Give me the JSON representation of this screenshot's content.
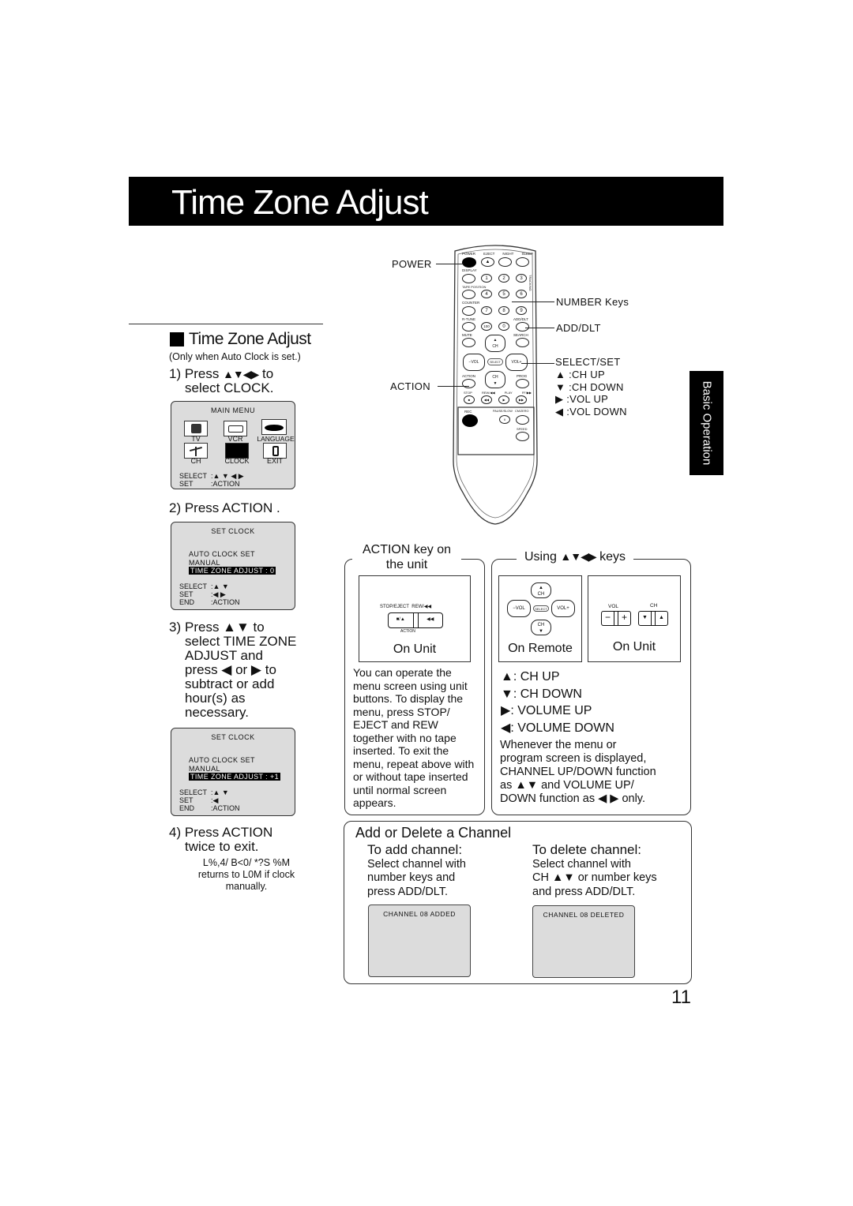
{
  "page": {
    "title": "Time Zone Adjust",
    "side_tab": "Basic Operation",
    "page_number": "11"
  },
  "left": {
    "heading": "Time Zone Adjust",
    "note": "(Only when Auto Clock is set.)",
    "step1": {
      "num": "1)",
      "line1_pre": "Press",
      "arrows": "▲▼◀▶",
      "line1_post": "to",
      "line2": "select  CLOCK."
    },
    "main_menu": {
      "title": "MAIN MENU",
      "items": [
        "TV",
        "VCR",
        "LANGUAGE",
        "CH",
        "CLOCK",
        "EXIT"
      ],
      "selected": "CLOCK",
      "controls": [
        {
          "key": "SELECT",
          "value": ":▲ ▼ ◀ ▶"
        },
        {
          "key": "SET",
          "value": ":ACTION"
        }
      ]
    },
    "step2": {
      "text": "2) Press ACTION ."
    },
    "set_clock_1": {
      "title": "SET CLOCK",
      "lines": [
        "AUTO CLOCK SET",
        "MANUAL"
      ],
      "highlight": "TIME ZONE ADJUST  : 0",
      "controls": [
        {
          "key": "SELECT",
          "value": ":▲ ▼"
        },
        {
          "key": "SET",
          "value": ":◀ ▶"
        },
        {
          "key": "END",
          "value": ":ACTION"
        }
      ]
    },
    "step3": {
      "num": "3)",
      "lines": [
        "Press ▲▼ to",
        "select TIME ZONE",
        "ADJUST and",
        "press ◀ or ▶ to",
        "subtract or add",
        "hour(s) as",
        "necessary."
      ]
    },
    "set_clock_2": {
      "title": "SET CLOCK",
      "lines": [
        "AUTO CLOCK SET",
        "MANUAL"
      ],
      "highlight": "TIME ZONE ADJUST  : +1",
      "controls": [
        {
          "key": "SELECT",
          "value": ":▲ ▼"
        },
        {
          "key": "SET",
          "value": ":◀"
        },
        {
          "key": "END",
          "value": ":ACTION"
        }
      ]
    },
    "step4": {
      "line1": "4) Press ACTION",
      "line2": "twice to exit."
    },
    "footnote": [
      "L%,4/ B<0/ *?S  %M",
      "returns to L0M if clock",
      "manually."
    ]
  },
  "remote": {
    "labels_left": {
      "power": "POWER",
      "action": "ACTION"
    },
    "labels_right": {
      "number_keys": "NUMBER  Keys",
      "add_dlt": "ADD/DLT",
      "select_set": "SELECT/SET",
      "legend": [
        {
          "icon": "▲",
          "text": ":CH UP"
        },
        {
          "icon": "▼",
          "text": ":CH DOWN"
        },
        {
          "icon": "▶",
          "text": ":VOL UP"
        },
        {
          "icon": "◀",
          "text": ":VOL DOWN"
        }
      ]
    },
    "button_labels": {
      "row1": [
        "POWER",
        "EJECT",
        "NIGHT",
        "SLEEP"
      ],
      "display": "DISPLAY",
      "tape_position": "TAPE POSITION",
      "counter": "COUNTER",
      "reset": "RESET",
      "r_tune": "R-TUNE",
      "add_dlt": "ADD/DLT",
      "mute": "MUTE",
      "search": "SEARCH",
      "tracking": "TRACKING",
      "digits": [
        "1",
        "2",
        "3",
        "4",
        "5",
        "6",
        "7",
        "8",
        "9",
        "100",
        "0"
      ],
      "ch": "CH",
      "vol_minus": "−VOL",
      "vol_plus": "VOL+",
      "select": "SELECT",
      "action": "ACTION",
      "prog": "PROG",
      "transport": [
        "STOP",
        "REW/◀◀",
        "PLAY",
        "FF/▶▶"
      ],
      "rec": "REC",
      "pause_slow": "PAUSE/SLOW",
      "cm_zero": "CM/ZERO",
      "speed": "SPEED"
    }
  },
  "action_box": {
    "title_line1": "ACTION key on",
    "title_line2": "the unit",
    "panel_label_left": "STOP/EJECT",
    "panel_label_right": "REW/◀◀",
    "btn_left": "■/▲",
    "btn_right": "◀◀",
    "action_caption": "ACTION",
    "caption": "On Unit",
    "body": "You can operate the menu screen using unit buttons. To display the menu, press STOP/ EJECT and REW together with no tape inserted. To exit the menu, repeat above with or without tape inserted until normal screen appears."
  },
  "keys_box": {
    "title_pre": "Using",
    "title_arrows": "▲▼◀▶",
    "title_post": "keys",
    "remote_caption": "On Remote",
    "unit_caption": "On Unit",
    "unit_vol_label": "VOL",
    "unit_ch_label": "CH",
    "unit_vol_buttons": [
      "−",
      "+"
    ],
    "unit_ch_buttons": [
      "▼",
      "▲"
    ],
    "legend": [
      {
        "icon": "▲",
        "text": ": CH UP"
      },
      {
        "icon": "▼",
        "text": ": CH DOWN"
      },
      {
        "icon": "▶",
        "text": ": VOLUME UP"
      },
      {
        "icon": "◀",
        "text": ": VOLUME DOWN"
      }
    ],
    "body_lines": [
      "Whenever the menu or",
      "program screen is displayed,",
      "CHANNEL UP/DOWN function",
      "as ▲▼ and VOLUME UP/",
      "DOWN function as ◀ ▶ only."
    ]
  },
  "add_delete": {
    "title": "Add or Delete a Channel",
    "add": {
      "heading": "To add channel:",
      "lines": [
        "Select channel with",
        "number keys and",
        "press ADD/DLT."
      ],
      "screen": "CHANNEL  08  ADDED"
    },
    "delete": {
      "heading": "To delete channel:",
      "lines": [
        "Select channel with",
        "CH ▲▼ or number keys",
        "and press ADD/DLT."
      ],
      "screen": "CHANNEL  08  DELETED"
    }
  }
}
